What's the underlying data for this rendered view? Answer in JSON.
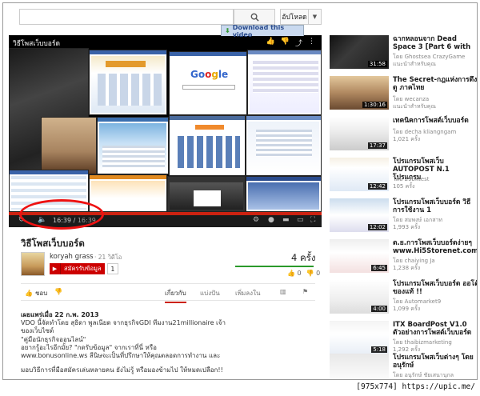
{
  "header": {
    "search_placeholder": "",
    "upload_label": "อัปโหลด"
  },
  "player": {
    "download_label": "Download this video",
    "title": "วิธีโพสเว็บบอร์ด",
    "time_current": "16:39",
    "time_total": "16:39"
  },
  "video": {
    "title": "วิธีโพสเว็บบอร์ด",
    "channel": "koryah grass",
    "channel_videos": "· 21 วิดีโอ",
    "subscribe_label": "สมัครรับข้อมูล",
    "subscribe_count": "1",
    "views": "4 ครั้ง",
    "likes": "0",
    "dislikes": "0"
  },
  "actions": {
    "like_label": "ชอบ",
    "about_tab": "เกี่ยวกับ",
    "share_tab": "แบ่งปัน",
    "add_tab": "เพิ่มลงใน"
  },
  "description": {
    "published": "เผยแพร่เมื่อ 22 ก.พ. 2013",
    "lines": [
      "VDO นี้จัดทำโดย สุธิดา พูลเนียด จากธุรกิจGDI ทีมงาน21millionaire เจ้า",
      "ของเว็บไซต์",
      "\"คู่มือนักธุรกิจออนไลน์\"",
      "อยากรู้อะไรอีกมั้ย? \"กดรับข้อมูล\" จากเราที่นี่ หรือ",
      "www.bonusonline.ws ลีนิษจะเป็นที่ปรึกษาให้คุณตลอดการทำงาน และ",
      "",
      "มอบวิธีการที่มือสมัครเล่นหลายคน ยังไม่รู้ หรือมองข้ามไป ให้หมดเปลือก!!"
    ]
  },
  "sidebar": [
    {
      "title": "ฉากหลอนจาก Dead Space 3 [Part 6 with",
      "by": "โดย Ghostsea CrazyGame",
      "meta": "แนะนำสำหรับคุณ",
      "duration": "31:58"
    },
    {
      "title": "The Secret-กฎแห่งการดึงดู ภาคไทย",
      "by": "โดย wecanza",
      "meta": "แนะนำสำหรับคุณ",
      "duration": "1:30:16"
    },
    {
      "title": "เทคนิคการโพสต์เว็บบอร์ด",
      "by": "โดย decha kliangngam",
      "meta": "1,021 ครั้ง",
      "duration": "17:37"
    },
    {
      "title": "โปรแกรมโพสเว็บ AUTOPOST N.1 โปรแกรม",
      "by": "โดย 29bktest",
      "meta": "105 ครั้ง",
      "duration": "12:42"
    },
    {
      "title": "โปรแกรมโพสเว็บบอร์ด วิธีการใช้งาน 1",
      "by": "โดย สมพงษ์ เอกสาท",
      "meta": "1,993 ครั้ง",
      "duration": "12:02"
    },
    {
      "title": "ต.ย.การโพสเว็บบอร์ดง่ายๆ www.Hi5Storenet.com",
      "by": "โดย chaiying Ja",
      "meta": "1,238 ครั้ง",
      "duration": "6:45"
    },
    {
      "title": "โปรแกรมโพสเว็บบอร์ด ออโต้ ของแท้ !!",
      "by": "โดย Automarket9",
      "meta": "1,099 ครั้ง",
      "duration": "4:00"
    },
    {
      "title": "ITX BoardPost V1.0 ตัวอย่างการโพสต์เว็บบอร์ด",
      "by": "โดย thaibizmarketing",
      "meta": "1,292 ครั้ง",
      "duration": "5:18"
    },
    {
      "title": "โปรแกรมโพสเว็บต่างๆ โดยอนุรักษ์",
      "by": "โดย อนุรักษ์ ชัยเสนานุกล",
      "meta": "",
      "duration": ""
    }
  ],
  "watermark": "[975x774] https://upic.me/"
}
